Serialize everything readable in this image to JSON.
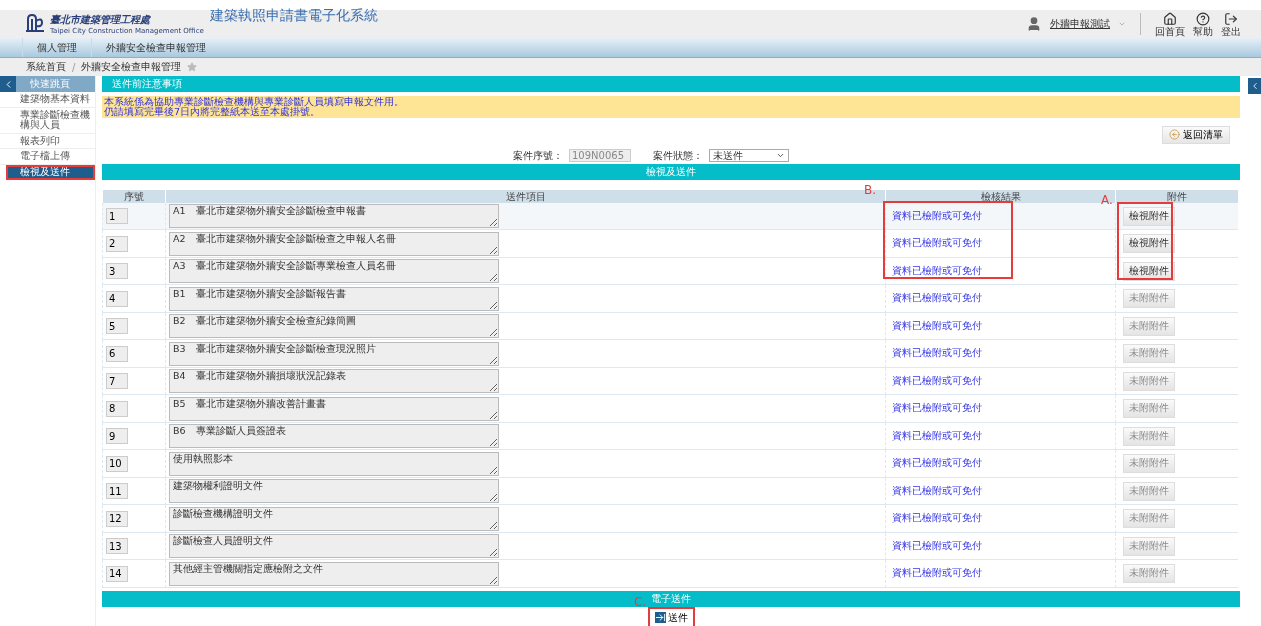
{
  "header": {
    "org_name": "臺北市建築管理工程處",
    "org_name_en": "Taipei City Construction Management Office",
    "system_title": "建築執照申請書電子化系統",
    "user": "外牆申報測試",
    "actions": [
      {
        "kind": "home",
        "label": "回首頁"
      },
      {
        "kind": "help",
        "label": "幫助"
      },
      {
        "kind": "logout",
        "label": "登出"
      }
    ]
  },
  "nav": [
    {
      "label": "個人管理"
    },
    {
      "label": "外牆安全檢查申報管理"
    }
  ],
  "breadcrumb": [
    "系統首頁",
    "外牆安全檢查申報管理"
  ],
  "breadcrumb_separator": "/",
  "sidebar": {
    "title": "快速跳頁",
    "items": [
      {
        "label": "建築物基本資料",
        "selected": false
      },
      {
        "label": "專業診斷檢查機構與人員",
        "selected": false
      },
      {
        "label": "報表列印",
        "selected": false
      },
      {
        "label": "電子檔上傳",
        "selected": false
      },
      {
        "label": "檢視及送件",
        "selected": true
      }
    ]
  },
  "notice": {
    "title": "送件前注意事項",
    "lines": [
      "本系統係為協助專業診斷檢查機構與專業診斷人員填寫申報文件用。",
      "仍請填寫完畢後7日內將完整紙本送至本處掛號。"
    ]
  },
  "back_button": "返回清單",
  "case": {
    "number_label": "案件序號：",
    "number": "109N0065",
    "status_label": "案件狀態：",
    "status": "未送件"
  },
  "review": {
    "title": "檢視及送件",
    "columns": [
      "序號",
      "送件項目",
      "檢核結果",
      "附件"
    ],
    "rows": [
      {
        "no": "1",
        "item": "A1　臺北市建築物外牆安全診斷檢查申報書",
        "result": "資料已檢附或可免付",
        "attachment": "檢視附件",
        "disabled": false
      },
      {
        "no": "2",
        "item": "A2　臺北市建築物外牆安全診斷檢查之申報人名冊",
        "result": "資料已檢附或可免付",
        "attachment": "檢視附件",
        "disabled": false
      },
      {
        "no": "3",
        "item": "A3　臺北市建築物外牆安全診斷專業檢查人員名冊",
        "result": "資料已檢附或可免付",
        "attachment": "檢視附件",
        "disabled": false
      },
      {
        "no": "4",
        "item": "B1　臺北市建築物外牆安全診斷報告書",
        "result": "資料已檢附或可免付",
        "attachment": "未附附件",
        "disabled": true
      },
      {
        "no": "5",
        "item": "B2　臺北市建築物外牆安全檢查紀錄簡圖",
        "result": "資料已檢附或可免付",
        "attachment": "未附附件",
        "disabled": true
      },
      {
        "no": "6",
        "item": "B3　臺北市建築物外牆安全診斷檢查現況照片",
        "result": "資料已檢附或可免付",
        "attachment": "未附附件",
        "disabled": true
      },
      {
        "no": "7",
        "item": "B4　臺北市建築物外牆損壞狀況記錄表",
        "result": "資料已檢附或可免付",
        "attachment": "未附附件",
        "disabled": true
      },
      {
        "no": "8",
        "item": "B5　臺北市建築物外牆改善計畫書",
        "result": "資料已檢附或可免付",
        "attachment": "未附附件",
        "disabled": true
      },
      {
        "no": "9",
        "item": "B6　專業診斷人員簽證表",
        "result": "資料已檢附或可免付",
        "attachment": "未附附件",
        "disabled": true
      },
      {
        "no": "10",
        "item": "使用執照影本",
        "result": "資料已檢附或可免付",
        "attachment": "未附附件",
        "disabled": true
      },
      {
        "no": "11",
        "item": "建築物權利證明文件",
        "result": "資料已檢附或可免付",
        "attachment": "未附附件",
        "disabled": true
      },
      {
        "no": "12",
        "item": "診斷檢查機構證明文件",
        "result": "資料已檢附或可免付",
        "attachment": "未附附件",
        "disabled": true
      },
      {
        "no": "13",
        "item": "診斷檢查人員證明文件",
        "result": "資料已檢附或可免付",
        "attachment": "未附附件",
        "disabled": true
      },
      {
        "no": "14",
        "item": "其他經主管機關指定應檢附之文件",
        "result": "資料已檢附或可免付",
        "attachment": "未附附件",
        "disabled": true
      }
    ]
  },
  "submit": {
    "title": "電子送件",
    "button": "送件"
  },
  "annotations": [
    {
      "label": "B."
    },
    {
      "label": "A."
    },
    {
      "label": "C."
    }
  ]
}
